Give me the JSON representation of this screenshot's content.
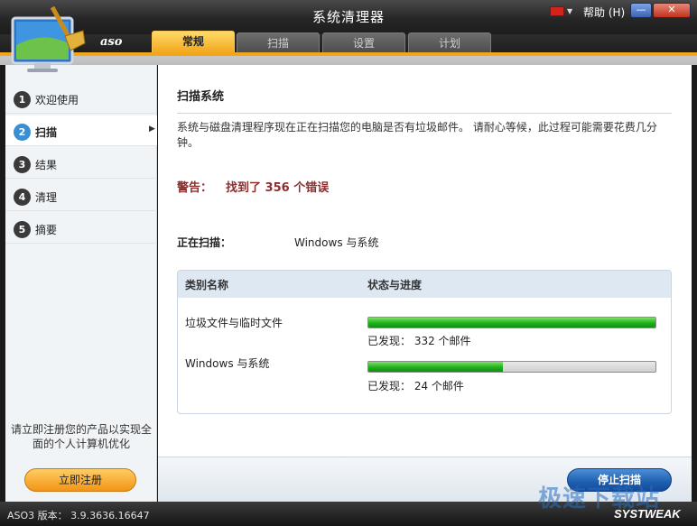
{
  "window": {
    "title": "系统清理器",
    "help_label": "帮助 (H)",
    "brand": "aso"
  },
  "tabs": [
    {
      "label": "常规",
      "active": true
    },
    {
      "label": "扫描",
      "active": false
    },
    {
      "label": "设置",
      "active": false
    },
    {
      "label": "计划",
      "active": false
    }
  ],
  "sidebar": {
    "items": [
      {
        "num": "1",
        "label": "欢迎使用",
        "active": false
      },
      {
        "num": "2",
        "label": "扫描",
        "active": true
      },
      {
        "num": "3",
        "label": "结果",
        "active": false
      },
      {
        "num": "4",
        "label": "清理",
        "active": false
      },
      {
        "num": "5",
        "label": "摘要",
        "active": false
      }
    ],
    "promo": "请立即注册您的产品以实现全面的个人计算机优化",
    "register_label": "立即注册"
  },
  "main": {
    "title": "扫描系统",
    "description": "系统与磁盘清理程序现在正在扫描您的电脑是否有垃圾邮件。 请耐心等候，此过程可能需要花费几分钟。",
    "warning_label": "警告：",
    "warning_value": "找到了 356 个错误",
    "scanning_label": "正在扫描：",
    "scanning_value": "Windows 与系统",
    "table": {
      "headers": [
        "类别名称",
        "状态与进度"
      ],
      "rows": [
        {
          "category": "垃圾文件与临时文件",
          "progress": 1.0,
          "found": "已发现： 332 个邮件"
        },
        {
          "category": "Windows 与系统",
          "progress": 0.47,
          "found": "已发现： 24 个邮件"
        }
      ]
    },
    "stop_label": "停止扫描"
  },
  "status": {
    "version": "ASO3 版本： 3.9.3636.16647",
    "brand": "SYSTWEAK",
    "watermark": "极速下载站"
  },
  "colors": {
    "accent_orange": "#f1a61d",
    "progress_green": "#1fb21d",
    "warning_red": "#8b2e2e",
    "button_blue": "#1d5fae"
  }
}
